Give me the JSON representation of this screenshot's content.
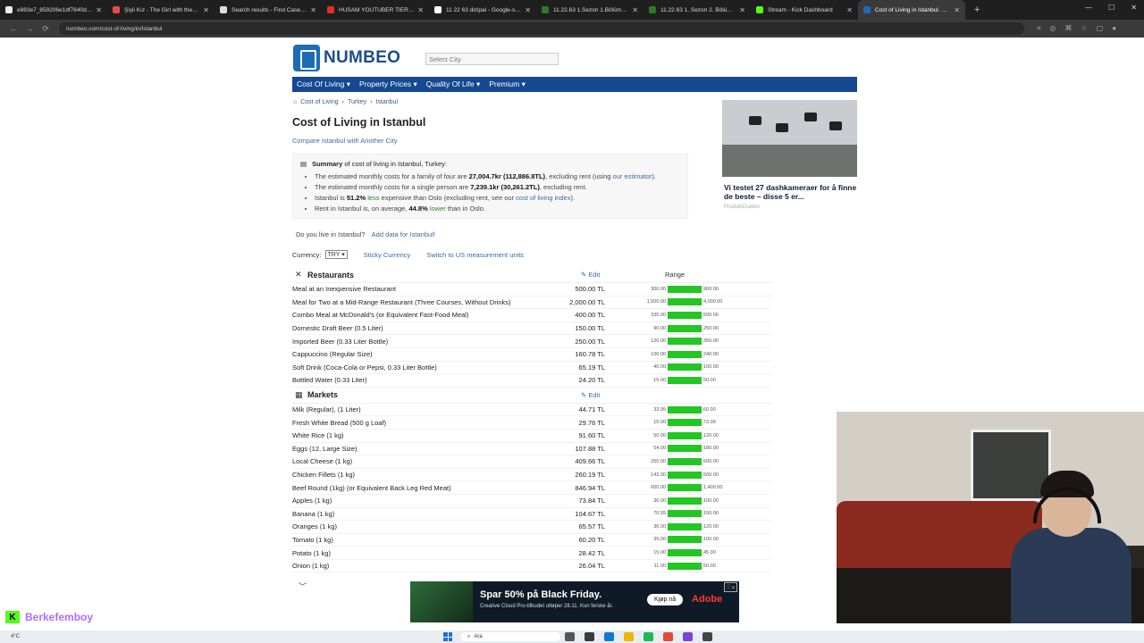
{
  "browser": {
    "tabs": [
      {
        "label": "e883e7_859206e1df7640d884f",
        "color": "#eeeeee"
      },
      {
        "label": "Şişli Kız - The Girl with the Ne",
        "color": "#e34b4b"
      },
      {
        "label": "Search results - Find Case Law",
        "color": "#dddddd"
      },
      {
        "label": "HUSAM YOUTUBER TİER LİST",
        "color": "#e52d27"
      },
      {
        "label": "11 22 63 dizipal - Google-søk",
        "color": "#ffffff"
      },
      {
        "label": "11.22.63 1.Sezon 1.Bölüm - Di",
        "color": "#2d7a2d"
      },
      {
        "label": "11.22.63 1. Sezon 2. Bölüm izle",
        "color": "#2d7a2d"
      },
      {
        "label": "Stream - Kick Dashboard",
        "color": "#53fc18"
      },
      {
        "label": "Cost of Living in Istanbul. Nov",
        "color": "#1c6cb6"
      }
    ],
    "new_tab": "+",
    "url": "numbeo.com/cost-of-living/in/Istanbul"
  },
  "site": {
    "logo": "NUMBEO",
    "city_placeholder": "Select City",
    "menu": [
      "Cost Of Living ▾",
      "Property Prices ▾",
      "Quality Of Life ▾",
      "Premium ▾"
    ]
  },
  "breadcrumb": {
    "home_icon": "home-icon",
    "items": [
      "Cost of Living",
      "Turkey",
      "Istanbul"
    ],
    "sep": "›"
  },
  "title": "Cost of Living in Istanbul",
  "compare_link": "Compare Istanbul with Another City",
  "summary": {
    "title_bold": "Summary",
    "title_rest": " of cost of living in Istanbul, Turkey:",
    "b1": {
      "pre": "The estimated monthly costs for a family of four are ",
      "val": "27,004.7kr (112,886.8TL)",
      "mid": ", excluding rent (using ",
      "link": "our estimator",
      "post": ")."
    },
    "b2": {
      "pre": "The estimated monthly costs for a single person are ",
      "val": "7,239.1kr (30,261.2TL)",
      "post": ", excluding rent."
    },
    "b3": {
      "pre": "Istanbul is ",
      "val": "51.2%",
      "grn": " less",
      "mid": " expensive than Oslo (excluding rent, see our ",
      "link": "cost of living index",
      "post": ")."
    },
    "b4": {
      "pre": "Rent in Istanbul is, on average, ",
      "val": "44.8%",
      "grn": " lower",
      "post": " than in Oslo."
    }
  },
  "live": {
    "q": "Do you live in Istanbul?",
    "link": "Add data for Istanbul!"
  },
  "currency": {
    "label": "Currency:",
    "value": "TRY ▾",
    "sticky": "Sticky Currency",
    "switch": "Switch to US measurement units"
  },
  "restaurants": {
    "name": "Restaurants",
    "edit": "Edit",
    "range": "Range",
    "rows": [
      {
        "item": "Meal at an Inexpensive Restaurant",
        "price": "500.00 TL",
        "lo": "300.00",
        "hi": "900.00"
      },
      {
        "item": "Meal for Two at a Mid-Range Restaurant (Three Courses, Without Drinks)",
        "price": "2,000.00 TL",
        "lo": "1,500.00",
        "hi": "4,000.00"
      },
      {
        "item": "Combo Meal at McDonald's (or Equivalent Fast-Food Meal)",
        "price": "400.00 TL",
        "lo": "335.00",
        "hi": "500.00"
      },
      {
        "item": "Domestic Draft Beer (0.5 Liter)",
        "price": "150.00 TL",
        "lo": "90.00",
        "hi": "250.00"
      },
      {
        "item": "Imported Beer (0.33 Liter Bottle)",
        "price": "250.00 TL",
        "lo": "120.00",
        "hi": "350.00"
      },
      {
        "item": "Cappuccino (Regular Size)",
        "price": "160.78 TL",
        "lo": "100.00",
        "hi": "240.00"
      },
      {
        "item": "Soft Drink (Coca-Cola or Pepsi, 0.33 Liter Bottle)",
        "price": "65.19 TL",
        "lo": "40.00",
        "hi": "100.00"
      },
      {
        "item": "Bottled Water (0.33 Liter)",
        "price": "24.20 TL",
        "lo": "15.00",
        "hi": "50.00"
      }
    ]
  },
  "markets": {
    "name": "Markets",
    "edit": "Edit",
    "rows": [
      {
        "item": "Milk (Regular), (1 Liter)",
        "price": "44.71 TL",
        "lo": "33.95",
        "hi": "60.00"
      },
      {
        "item": "Fresh White Bread (500 g Loaf)",
        "price": "29.76 TL",
        "lo": "15.00",
        "hi": "73.00"
      },
      {
        "item": "White Rice (1 kg)",
        "price": "91.60 TL",
        "lo": "50.00",
        "hi": "120.00"
      },
      {
        "item": "Eggs (12, Large Size)",
        "price": "107.88 TL",
        "lo": "54.00",
        "hi": "180.00"
      },
      {
        "item": "Local Cheese (1 kg)",
        "price": "409.66 TL",
        "lo": "250.00",
        "hi": "600.00"
      },
      {
        "item": "Chicken Fillets (1 kg)",
        "price": "260.19 TL",
        "lo": "143.30",
        "hi": "500.00"
      },
      {
        "item": "Beef Round (1kg) (or Equivalent Back Leg Red Meat)",
        "price": "846.94 TL",
        "lo": "600.00",
        "hi": "1,400.00"
      },
      {
        "item": "Apples (1 kg)",
        "price": "73.84 TL",
        "lo": "36.00",
        "hi": "100.00"
      },
      {
        "item": "Banana (1 kg)",
        "price": "104.67 TL",
        "lo": "70.55",
        "hi": "150.00"
      },
      {
        "item": "Oranges (1 kg)",
        "price": "65.57 TL",
        "lo": "36.00",
        "hi": "120.00"
      },
      {
        "item": "Tomato (1 kg)",
        "price": "60.20 TL",
        "lo": "35.00",
        "hi": "100.00"
      },
      {
        "item": "Potato (1 kg)",
        "price": "28.42 TL",
        "lo": "15.00",
        "hi": "45.00"
      },
      {
        "item": "Onion (1 kg)",
        "price": "26.04 TL",
        "lo": "11.00",
        "hi": "50.00"
      }
    ]
  },
  "ad_right": {
    "title": "Vi testet 27 dashkameraer for å finne de beste – disse 5 er...",
    "source": "ProduktGuiden"
  },
  "ad_bottom": {
    "headline": "Spar 50% på Black Friday.",
    "sub": "Creative Cloud Pro-tilbudet utløper 28.11. Kun ferske år.",
    "cta": "Kjøp nå",
    "brand": "Adobe"
  },
  "streamer": {
    "name": "Berkefemboy"
  },
  "taskbar": {
    "weather": "4°C",
    "search": "Ara"
  }
}
